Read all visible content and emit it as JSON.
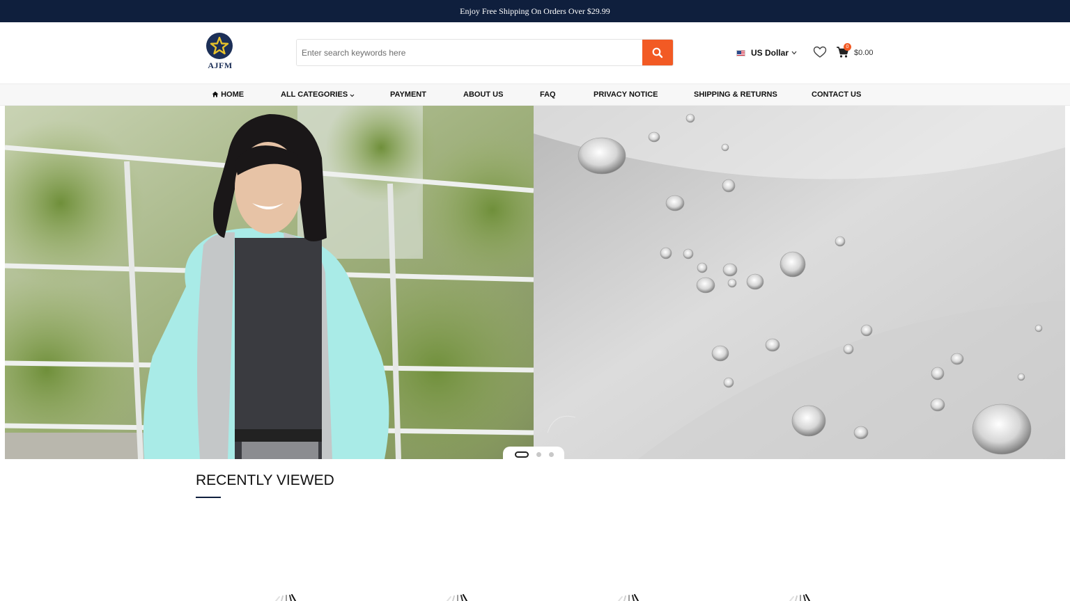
{
  "announcement": "Enjoy Free Shipping On Orders Over $29.99",
  "logo": {
    "brand": "AJFM",
    "icon": "star-icon"
  },
  "search": {
    "placeholder": "Enter search keywords here",
    "button_icon": "search-icon"
  },
  "currency": {
    "label": "US Dollar",
    "flag": "us-flag-icon"
  },
  "cart": {
    "count": "0",
    "total": "$0.00"
  },
  "nav": {
    "home": "HOME",
    "categories": "ALL CATEGORIES",
    "payment": "PAYMENT",
    "about": "ABOUT US",
    "faq": "FAQ",
    "privacy": "PRIVACY NOTICE",
    "shipping": "SHIPPING & RETURNS",
    "contact": "CONTACT US"
  },
  "slider": {
    "slide_count": 3,
    "active_index": 0
  },
  "recently_viewed": {
    "title": "RECENTLY VIEWED"
  },
  "colors": {
    "navy": "#0f1f3d",
    "accent": "#f25a24",
    "nav_bg": "#f7f7f7"
  }
}
